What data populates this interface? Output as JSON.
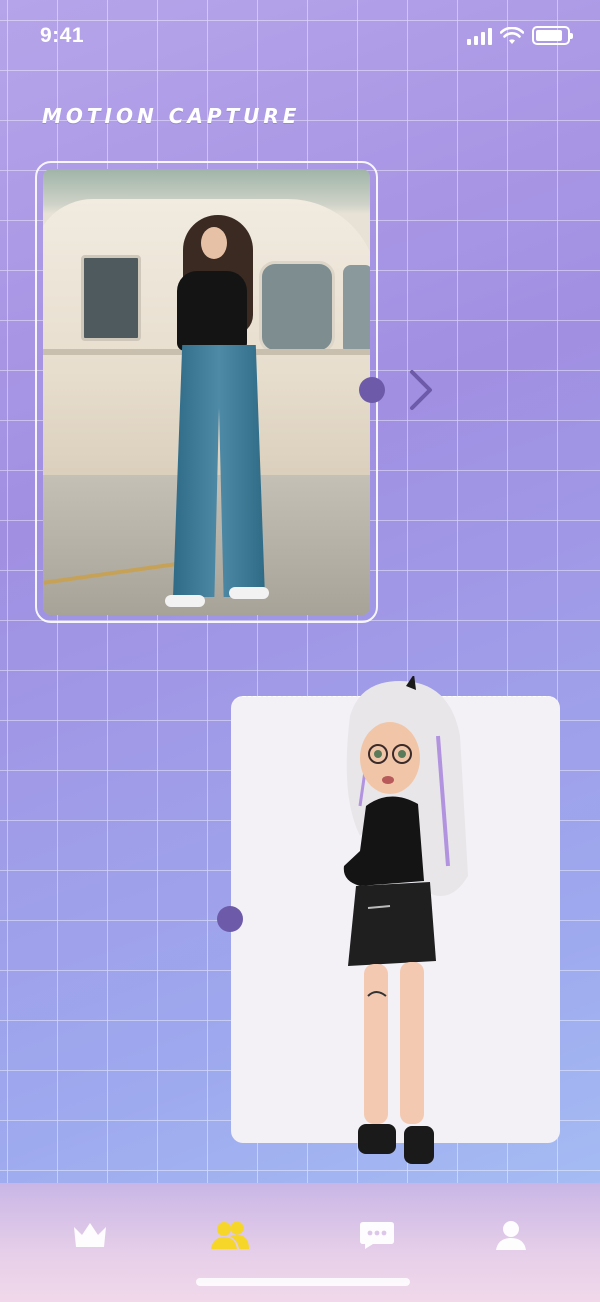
{
  "status_bar": {
    "time": "9:41",
    "signal_icon": "cellular-signal-icon",
    "wifi_icon": "wifi-icon",
    "battery_icon": "battery-icon",
    "battery_level": 0.85
  },
  "header": {
    "title": "Motion capture"
  },
  "source_photo": {
    "description_icon": "photo-image"
  },
  "next_arrow_icon": "chevron-right-icon",
  "avatar_result": {
    "icon": "avatar-3d-image"
  },
  "tab_bar": {
    "tabs": [
      {
        "icon": "crown-icon",
        "active": false
      },
      {
        "icon": "people-icon",
        "active": true
      },
      {
        "icon": "chat-bubble-icon",
        "active": false
      },
      {
        "icon": "user-profile-icon",
        "active": false
      }
    ]
  },
  "colors": {
    "accent": "#6d5aa9",
    "active_tab": "#f6d628",
    "inactive_tab": "#ffffff"
  }
}
